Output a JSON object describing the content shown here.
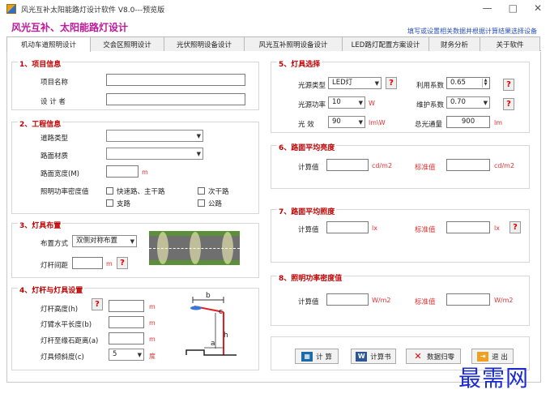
{
  "window": {
    "title": "风光互补太阳能路灯设计软件 V8.0---预览版",
    "controls": [
      "—",
      "□",
      "✕"
    ]
  },
  "header": {
    "heading": "风光互补、太阳能路灯设计",
    "hint": "填写或设置相关数据并根据计算结果选择设备"
  },
  "tabs": [
    "机动车道照明设计",
    "交会区照明设计",
    "光伏照明设备设计",
    "风光互补照明设备设计",
    "LED路灯配置方案设计",
    "财务分析",
    "关于软件"
  ],
  "sec1": {
    "title": "1、项目信息",
    "project_name_label": "项目名称",
    "project_name_value": "",
    "designer_label": "设  计  者",
    "designer_value": ""
  },
  "sec2": {
    "title": "2、工程信息",
    "road_type_label": "道路类型",
    "road_type_value": "",
    "surface_label": "路面材质",
    "surface_value": "",
    "width_label": "路面宽度(M)",
    "width_value": "",
    "width_unit": "m",
    "lpd_label": "照明功率密度值",
    "opt_expressway": "快速路、主干路",
    "opt_secondary": "次干路",
    "opt_branch": "支路",
    "opt_public": "公路"
  },
  "sec3": {
    "title": "3、灯具布置",
    "layout_label": "布置方式",
    "layout_value": "双侧对称布置",
    "spacing_label": "灯杆间距",
    "spacing_value": "",
    "spacing_unit": "m"
  },
  "sec4": {
    "title": "4、灯杆与灯具设置",
    "height_label": "灯杆高度(h)",
    "height_value": "",
    "height_unit": "m",
    "arm_label": "灯臂水平长度(b)",
    "arm_value": "",
    "arm_unit": "m",
    "curb_label": "灯杆至缘石距离(a)",
    "curb_value": "",
    "curb_unit": "m",
    "tilt_label": "灯具倾斜度(c)",
    "tilt_value": "5",
    "tilt_unit": "度",
    "diagram_labels": {
      "b": "b",
      "c": "c",
      "h": "h",
      "a": "a"
    }
  },
  "sec5": {
    "title": "5、灯具选择",
    "source_type_label": "光源类型",
    "source_type_value": "LED灯",
    "source_power_label": "光源功率",
    "source_power_value": "10",
    "source_power_unit": "W",
    "efficacy_label": "光  效",
    "efficacy_value": "90",
    "efficacy_unit": "lm\\W",
    "util_label": "利用系数",
    "util_value": "0.65",
    "maint_label": "维护系数",
    "maint_value": "0.70",
    "flux_label": "总光通量",
    "flux_value": "900",
    "flux_unit": "lm"
  },
  "sec6": {
    "title": "6、路面平均亮度",
    "calc_label": "计算值",
    "calc_value": "",
    "calc_unit": "cd/m2",
    "std_label": "标准值",
    "std_value": "",
    "std_unit": "cd/m2"
  },
  "sec7": {
    "title": "7、路面平均照度",
    "calc_label": "计算值",
    "calc_value": "",
    "calc_unit": "lx",
    "std_label": "标准值",
    "std_value": "",
    "std_unit": "lx"
  },
  "sec8": {
    "title": "8、照明功率密度值",
    "calc_label": "计算值",
    "calc_value": "",
    "calc_unit": "W/m2",
    "std_label": "标准值",
    "std_value": "",
    "std_unit": "W/m2"
  },
  "actions": {
    "calc": "计  算",
    "report": "计算书",
    "reset": "数据归零",
    "exit": "退  出"
  },
  "question_mark": "?",
  "watermark": "最需网",
  "colors": {
    "accent": "#c0179b",
    "section_title": "#c00000",
    "unit": "#e03030",
    "hint": "#2a4fb5"
  }
}
